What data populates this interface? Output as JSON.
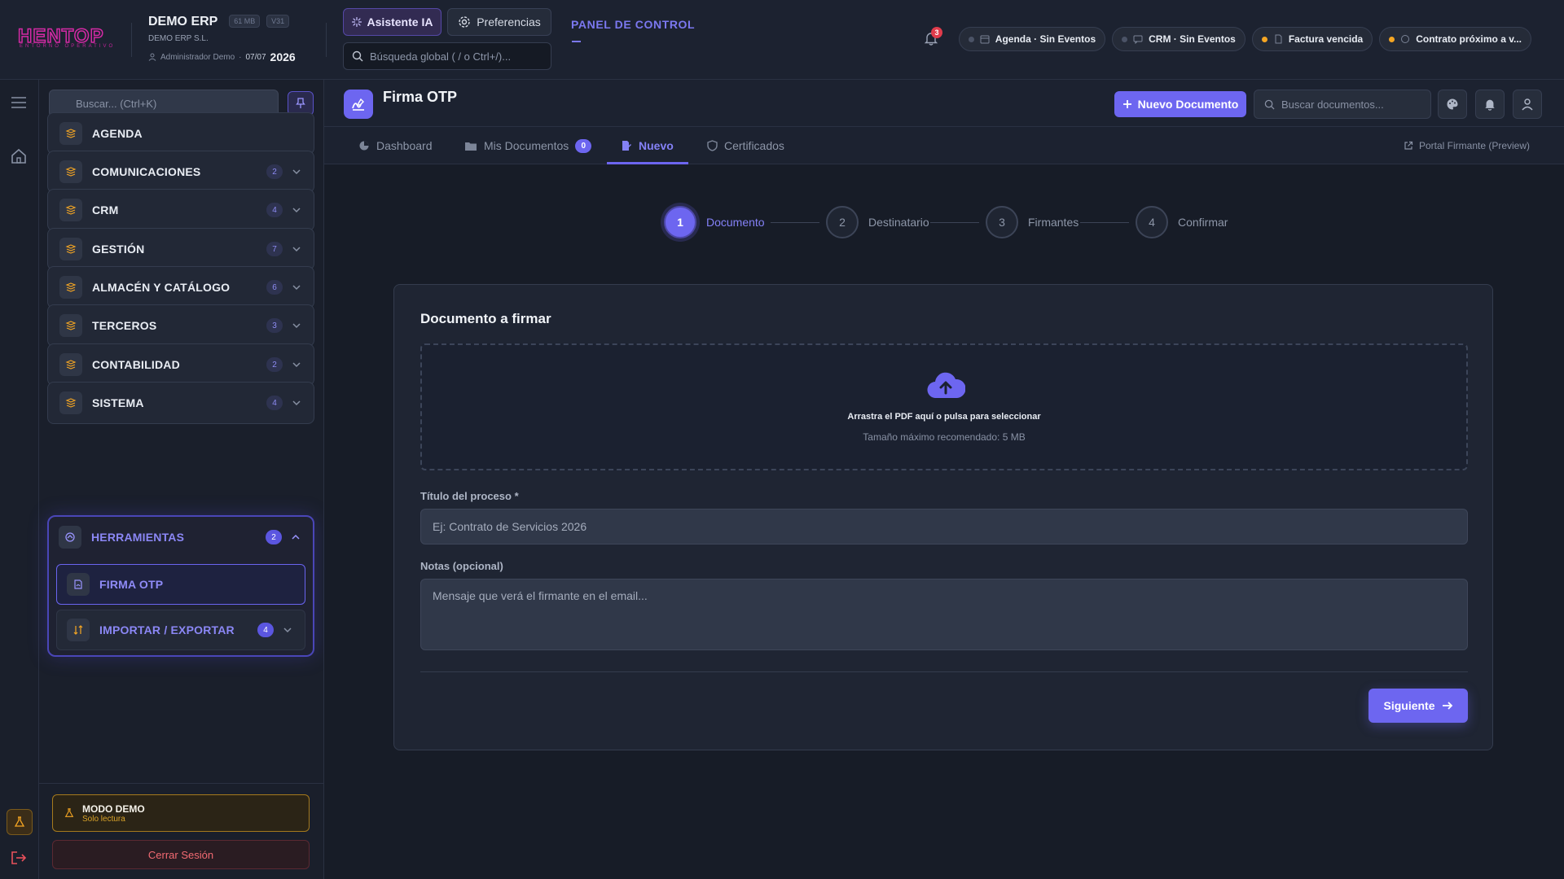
{
  "brand": {
    "logo_text": "HENTOP",
    "tagline": "ENTORNO OPERATIVO"
  },
  "company": {
    "name": "DEMO ERP",
    "size_chip": "61 MB",
    "version_chip": "V31",
    "legal_name": "DEMO ERP S.L.",
    "user": "Administrador Demo",
    "date": "07/07",
    "year": "2026"
  },
  "header": {
    "ai_button": "Asistente IA",
    "prefs_button": "Preferencias",
    "global_search_placeholder": "Búsqueda global ( / o Ctrl+/)...",
    "panel_title": "PANEL DE CONTROL",
    "notification_count": "3",
    "alerts": [
      {
        "label": "Agenda · Sin Eventos",
        "icon": "calendar-icon",
        "status": "neutral"
      },
      {
        "label": "CRM · Sin Eventos",
        "icon": "chat-icon",
        "status": "neutral"
      },
      {
        "label": "Factura vencida",
        "icon": "document-icon",
        "status": "warning"
      },
      {
        "label": "Contrato próximo a v...",
        "icon": "chat-icon",
        "status": "warning"
      }
    ]
  },
  "sidebar": {
    "search_placeholder": "Buscar... (Ctrl+K)",
    "items": [
      {
        "label": "AGENDA",
        "count": ""
      },
      {
        "label": "COMUNICACIONES",
        "count": "2"
      },
      {
        "label": "CRM",
        "count": "4"
      },
      {
        "label": "GESTIÓN",
        "count": "7"
      },
      {
        "label": "ALMACÉN Y CATÁLOGO",
        "count": "6"
      },
      {
        "label": "TERCEROS",
        "count": "3"
      },
      {
        "label": "CONTABILIDAD",
        "count": "2"
      },
      {
        "label": "SISTEMA",
        "count": "4"
      }
    ],
    "group": {
      "label": "HERRAMIENTAS",
      "count": "2",
      "children": [
        {
          "label": "FIRMA OTP",
          "count": ""
        },
        {
          "label": "IMPORTAR / EXPORTAR",
          "count": "4"
        }
      ]
    },
    "demo_title": "MODO DEMO",
    "demo_sub": "Solo lectura",
    "logout": "Cerrar Sesión"
  },
  "page": {
    "title": "Firma OTP",
    "new_button": "Nuevo Documento",
    "search_placeholder": "Buscar documentos...",
    "tabs": [
      {
        "label": "Dashboard",
        "badge": ""
      },
      {
        "label": "Mis Documentos",
        "badge": "0"
      },
      {
        "label": "Nuevo",
        "badge": ""
      },
      {
        "label": "Certificados",
        "badge": ""
      }
    ],
    "portal_link": "Portal Firmante (Preview)"
  },
  "stepper": [
    {
      "num": "1",
      "label": "Documento",
      "active": true
    },
    {
      "num": "2",
      "label": "Destinatario",
      "active": false
    },
    {
      "num": "3",
      "label": "Firmantes",
      "active": false
    },
    {
      "num": "4",
      "label": "Confirmar",
      "active": false
    }
  ],
  "form": {
    "card_title": "Documento a firmar",
    "dropzone_title": "Arrastra el PDF aquí o pulsa para seleccionar",
    "dropzone_sub": "Tamaño máximo recomendado: 5 MB",
    "title_label": "Título del proceso *",
    "title_placeholder": "Ej: Contrato de Servicios 2026",
    "notes_label": "Notas (opcional)",
    "notes_placeholder": "Mensaje que verá el firmante en el email...",
    "next_button": "Siguiente"
  },
  "colors": {
    "accent": "#6d66f0",
    "warning": "#f5a623",
    "danger": "#e03b4b",
    "brand": "#c0249a"
  }
}
